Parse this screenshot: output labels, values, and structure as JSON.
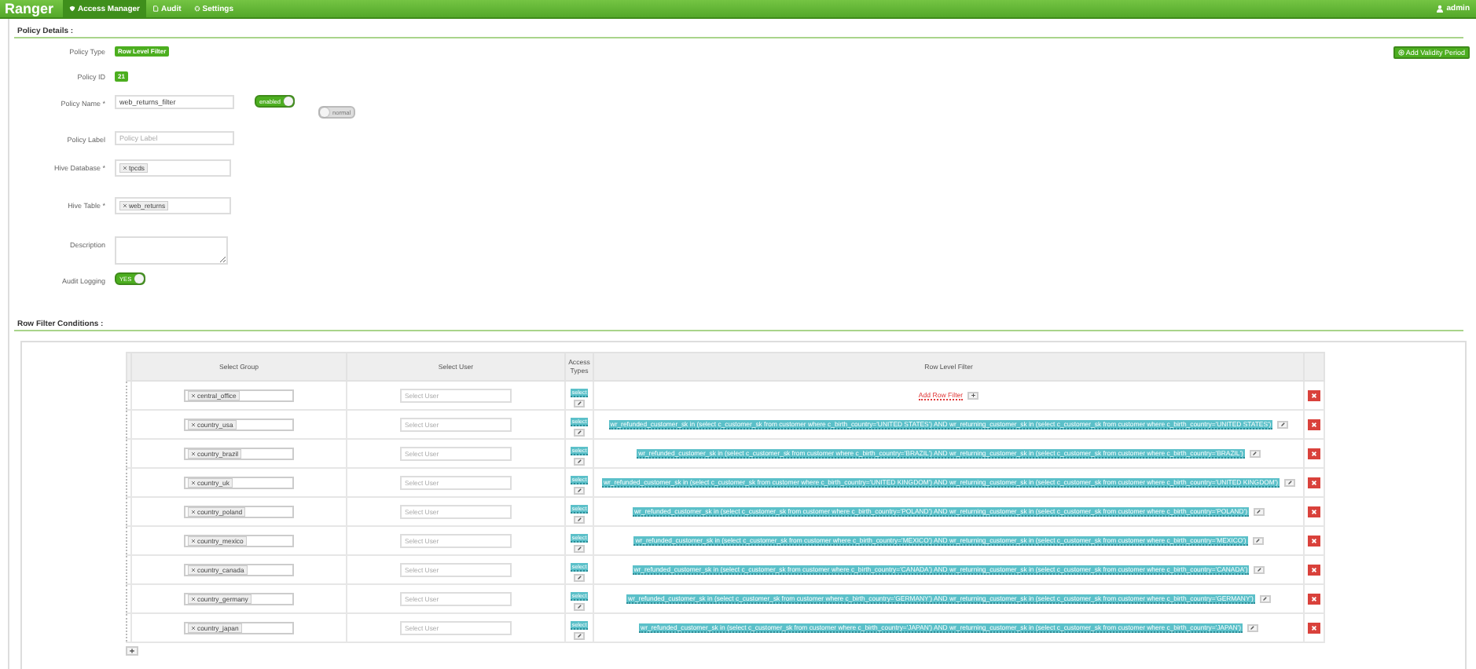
{
  "topbar": {
    "brand": "Ranger",
    "tabs": [
      {
        "label": "Access Manager",
        "selected": true
      },
      {
        "label": "Audit",
        "selected": false
      },
      {
        "label": "Settings",
        "selected": false
      }
    ],
    "user": "admin"
  },
  "policy_details": {
    "heading": "Policy Details :",
    "add_validity_button": "Add Validity Period",
    "fields": [
      {
        "kind": "badge",
        "label": "Policy Type",
        "value": "Row Level Filter"
      },
      {
        "kind": "badge",
        "label": "Policy ID",
        "value": "21"
      },
      {
        "kind": "input",
        "label": "Policy Name *",
        "value": "web_returns_filter",
        "toggles": [
          {
            "text": "enabled",
            "on": true
          },
          {
            "text": "normal",
            "on": false
          }
        ]
      },
      {
        "kind": "input",
        "label": "Policy Label",
        "placeholder": "Policy Label"
      },
      {
        "kind": "tags",
        "label": "Hive Database *",
        "tags": [
          "tpcds"
        ]
      },
      {
        "kind": "tags",
        "label": "Hive Table *",
        "tags": [
          "web_returns"
        ]
      },
      {
        "kind": "textarea",
        "label": "Description"
      },
      {
        "kind": "toggle",
        "label": "Audit Logging",
        "toggles": [
          {
            "text": "YES",
            "on": true
          }
        ]
      }
    ]
  },
  "row_filter": {
    "heading": "Row Filter Conditions :",
    "columns": [
      "Select Group",
      "Select User",
      "Access Types",
      "Row Level Filter"
    ],
    "rows": [
      {
        "group": "central_office",
        "user_placeholder": "Select User",
        "access": "select",
        "kind": "add",
        "add_label": "Add Row Filter"
      },
      {
        "group": "country_usa",
        "user_placeholder": "Select User",
        "access": "select",
        "kind": "filter",
        "filter": "wr_refunded_customer_sk in (select c_customer_sk from customer where c_birth_country='UNITED STATES') AND wr_returning_customer_sk in (select c_customer_sk from customer where c_birth_country='UNITED STATES')"
      },
      {
        "group": "country_brazil",
        "user_placeholder": "Select User",
        "access": "select",
        "kind": "filter",
        "filter": "wr_refunded_customer_sk in (select c_customer_sk from customer where c_birth_country='BRAZIL') AND wr_returning_customer_sk in (select c_customer_sk from customer where c_birth_country='BRAZIL')"
      },
      {
        "group": "country_uk",
        "user_placeholder": "Select User",
        "access": "select",
        "kind": "filter",
        "filter": "wr_refunded_customer_sk in (select c_customer_sk from customer where c_birth_country='UNITED KINGDOM') AND wr_returning_customer_sk in (select c_customer_sk from customer where c_birth_country='UNITED KINGDOM')"
      },
      {
        "group": "country_poland",
        "user_placeholder": "Select User",
        "access": "select",
        "kind": "filter",
        "filter": "wr_refunded_customer_sk in (select c_customer_sk from customer where c_birth_country='POLAND') AND wr_returning_customer_sk in (select c_customer_sk from customer where c_birth_country='POLAND')"
      },
      {
        "group": "country_mexico",
        "user_placeholder": "Select User",
        "access": "select",
        "kind": "filter",
        "filter": "wr_refunded_customer_sk in (select c_customer_sk from customer where c_birth_country='MEXICO') AND wr_returning_customer_sk in (select c_customer_sk from customer where c_birth_country='MEXICO')"
      },
      {
        "group": "country_canada",
        "user_placeholder": "Select User",
        "access": "select",
        "kind": "filter",
        "filter": "wr_refunded_customer_sk in (select c_customer_sk from customer where c_birth_country='CANADA') AND wr_returning_customer_sk in (select c_customer_sk from customer where c_birth_country='CANADA')"
      },
      {
        "group": "country_germany",
        "user_placeholder": "Select User",
        "access": "select",
        "kind": "filter",
        "filter": "wr_refunded_customer_sk in (select c_customer_sk from customer where c_birth_country='GERMANY') AND wr_returning_customer_sk in (select c_customer_sk from customer where c_birth_country='GERMANY')"
      },
      {
        "group": "country_japan",
        "user_placeholder": "Select User",
        "access": "select",
        "kind": "filter",
        "filter": "wr_refunded_customer_sk in (select c_customer_sk from customer where c_birth_country='JAPAN') AND wr_returning_customer_sk in (select c_customer_sk from customer where c_birth_country='JAPAN')"
      }
    ]
  }
}
